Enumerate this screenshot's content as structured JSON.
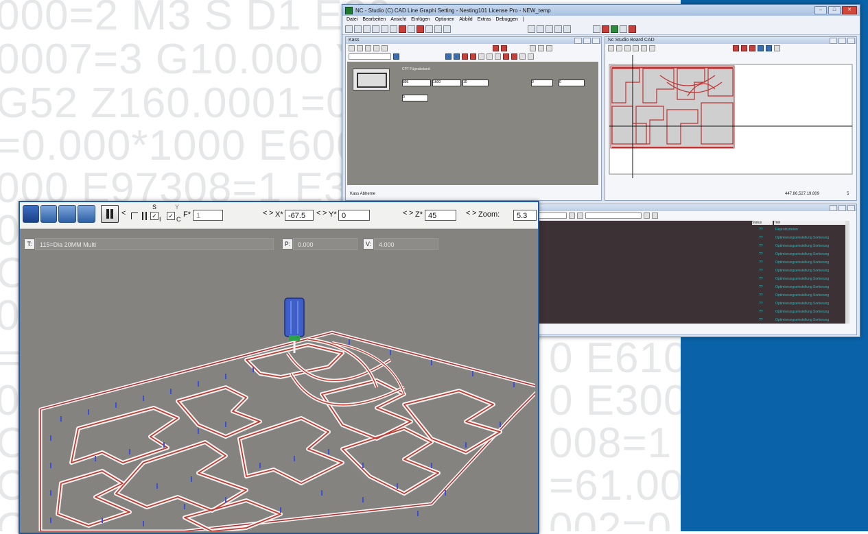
{
  "background": {
    "code_lines": [
      "000=2 M3 S D1 E30",
      "0007=3 G10.000 Y2",
      "G52 Z160.0001=0 C",
      "=0.000*1000 E6000",
      "000 E97308=1 E3",
      "0",
      "C",
      "0",
      "=",
      "0",
      "C",
      "C",
      "C"
    ],
    "code_right": [
      "0 E610",
      "0 E3001",
      "008=1 E",
      "=61.000",
      "002=0 E"
    ],
    "panel_color": "#0a62a8"
  },
  "main_window": {
    "title": "NC - Studio (C) CAD Line Graphi Setting - Nesting101 License Pro - NEW_temp",
    "menu": [
      "Datei",
      "Bearbeiten",
      "Ansicht",
      "Einfügen",
      "Optionen",
      "Abbild",
      "Extras",
      "Debuggen",
      "|"
    ],
    "left_pane_title": "Kass",
    "right_pane_title": "Nc Studio Board CAD",
    "param_header": "CPT Fügeabstand",
    "fields": [
      "895",
      "1600",
      "10",
      "0",
      "0",
      "0"
    ],
    "left_status": "Kass Abheme",
    "coords": "447.86,527.19.809",
    "coords_num": "5",
    "console_header_a": "Status",
    "console_header_b": "Titel",
    "console_first": "Reproduzieren",
    "console_line": "Optimierungseinstellung Sortierung",
    "console_num": "??"
  },
  "viewer": {
    "checks": {
      "s": "S",
      "i": "I",
      "c": "C",
      "y": "Y"
    },
    "f_label": "F*",
    "f_value": "1",
    "x_label": "X*",
    "x_value": "-67.5",
    "y_label": "Y*",
    "y_value": "0",
    "z_label": "Z*",
    "z_value": "45",
    "zoom_label": "Zoom:",
    "zoom_value": "5.3",
    "t_label": "T:",
    "t_value": "115=Dia 20MM Multi",
    "p_label": "P:",
    "p_value": "0.000",
    "v_label": "V:",
    "v_value": "4.000",
    "arrow_left": "<",
    "arrow_right": ">"
  }
}
